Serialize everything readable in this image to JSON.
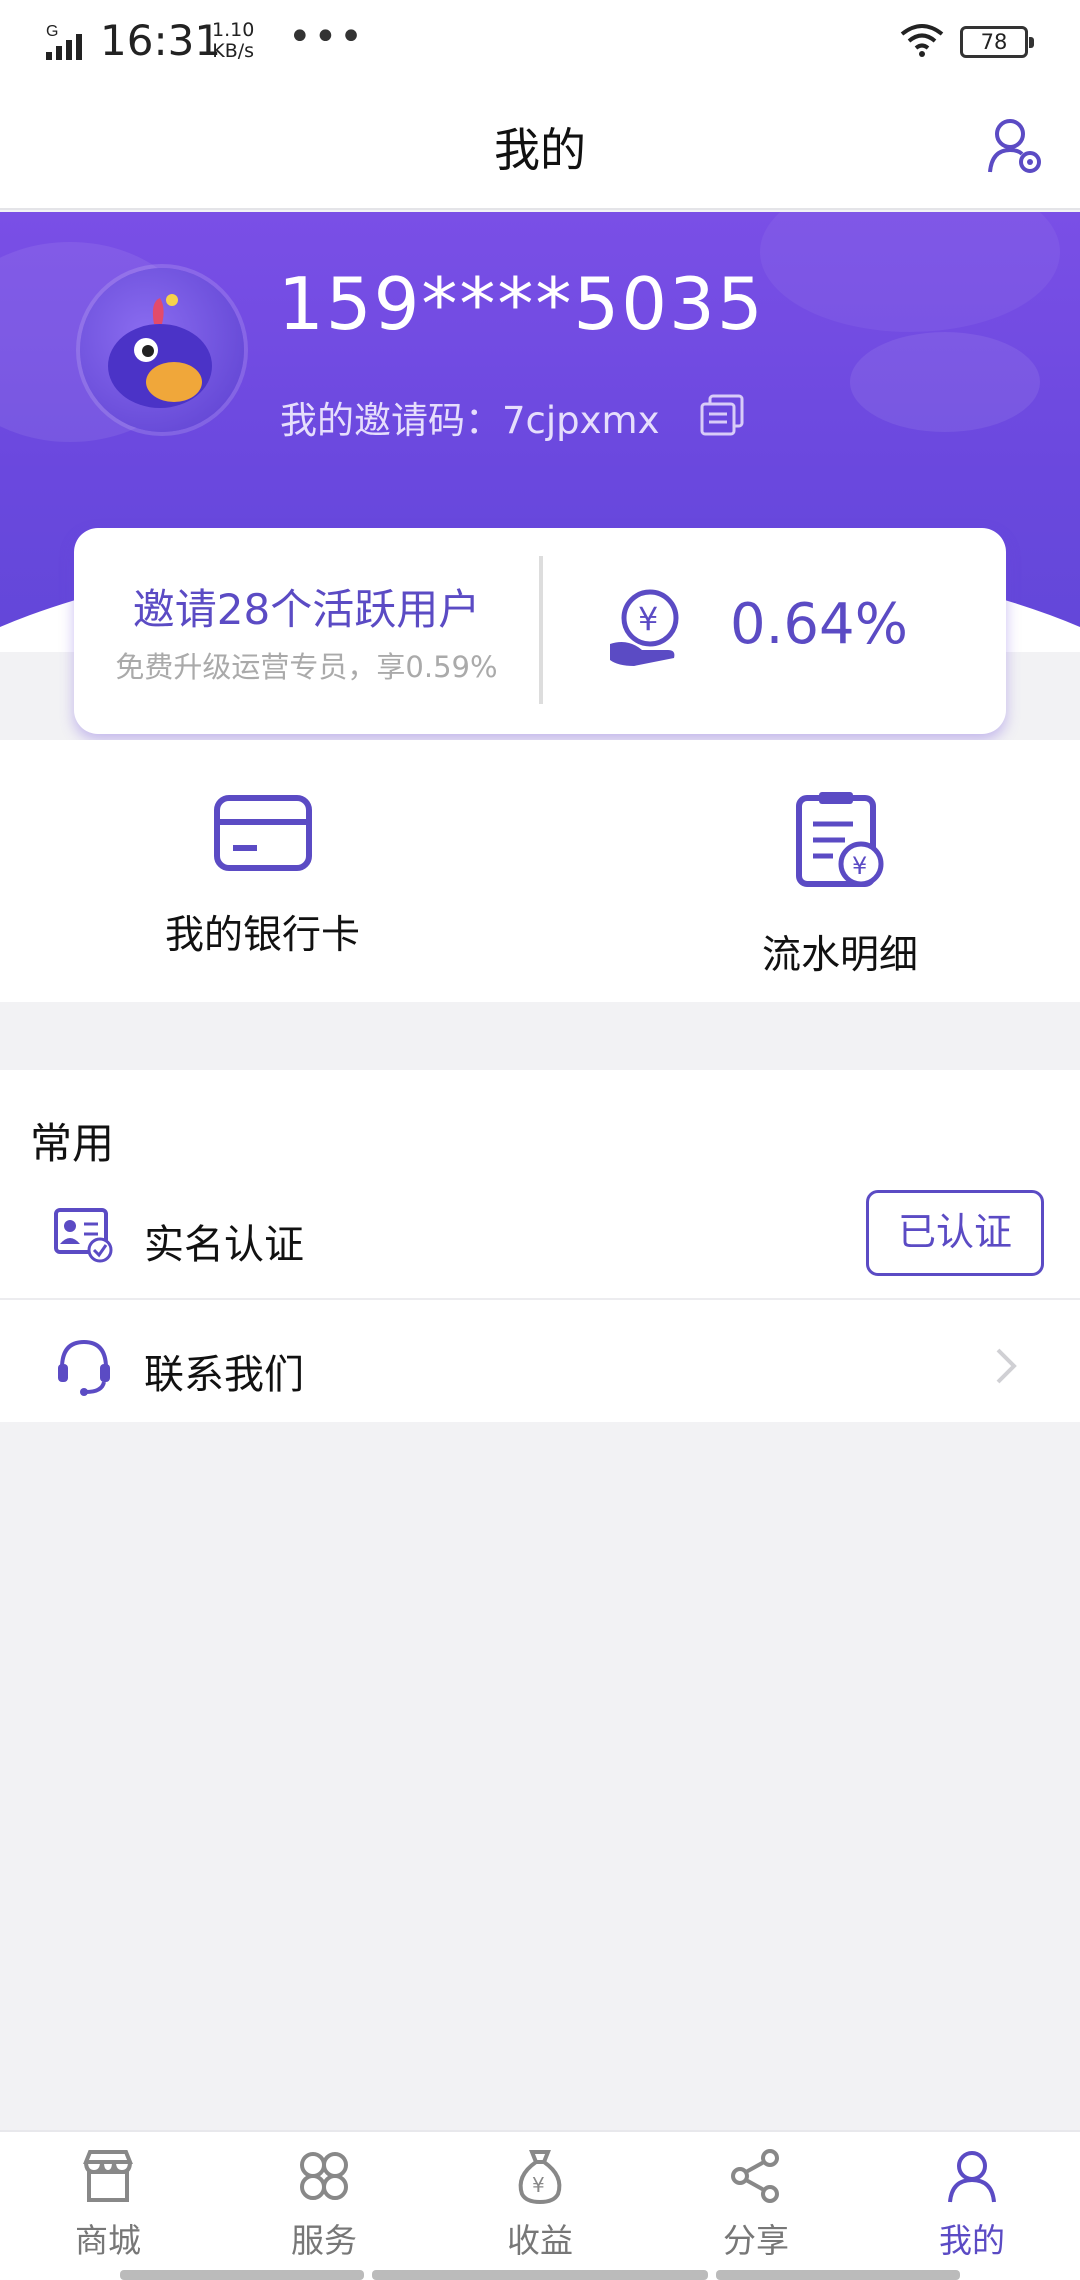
{
  "status_bar": {
    "network": "G",
    "time": "16:31",
    "speed_value": "1.10",
    "speed_unit": "KB/s",
    "more": "•••",
    "battery": "78"
  },
  "header": {
    "title": "我的",
    "settings_icon": "user-settings-icon"
  },
  "profile": {
    "phone": "159****5035",
    "invite_label": "我的邀请码：",
    "invite_code": "7cjpxmx",
    "copy_icon": "copy-icon",
    "accent": "#6a48de"
  },
  "stat_card": {
    "main": "邀请28个活跃用户",
    "sub": "免费升级运营专员，享0.59%",
    "rate": "0.64%",
    "rate_icon": "yuan-hand-icon"
  },
  "quick_actions": [
    {
      "label": "我的银行卡",
      "icon": "bank-card-icon"
    },
    {
      "label": "流水明细",
      "icon": "statement-icon"
    }
  ],
  "common": {
    "title": "常用",
    "items": [
      {
        "label": "实名认证",
        "status": "已认证",
        "icon": "id-card-icon"
      },
      {
        "label": "联系我们",
        "icon": "headset-icon"
      }
    ]
  },
  "tabbar": {
    "items": [
      {
        "label": "商城",
        "icon": "store-icon"
      },
      {
        "label": "服务",
        "icon": "grid-icon"
      },
      {
        "label": "收益",
        "icon": "money-bag-icon"
      },
      {
        "label": "分享",
        "icon": "share-icon"
      },
      {
        "label": "我的",
        "icon": "user-icon",
        "active": true
      }
    ]
  }
}
